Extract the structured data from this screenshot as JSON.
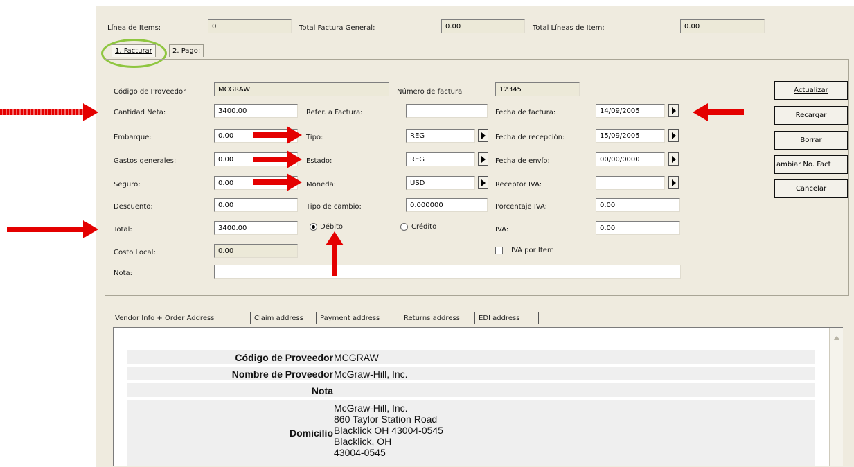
{
  "header": {
    "linea_items_label": "Línea de Items:",
    "linea_items_value": "0",
    "total_factura_label": "Total Factura General:",
    "total_factura_value": "0.00",
    "total_lineas_label": "Total Líneas de Item:",
    "total_lineas_value": "0.00"
  },
  "tabs": [
    "1. Facturar",
    "2. Pago:"
  ],
  "form": {
    "codigo_proveedor_label": "Código de Proveedor",
    "codigo_proveedor_value": "MCGRAW",
    "numero_factura_label": "Número de factura",
    "numero_factura_value": "12345",
    "cantidad_neta_label": "Cantidad Neta:",
    "cantidad_neta_value": "3400.00",
    "embarque_label": "Embarque:",
    "embarque_value": "0.00",
    "gastos_label": "Gastos generales:",
    "gastos_value": "0.00",
    "seguro_label": "Seguro:",
    "seguro_value": "0.00",
    "descuento_label": "Descuento:",
    "descuento_value": "0.00",
    "total_label": "Total:",
    "total_value": "3400.00",
    "costo_local_label": "Costo Local:",
    "costo_local_value": "0.00",
    "nota_label": "Nota:",
    "nota_value": "",
    "refer_label": "Refer. a Factura:",
    "refer_value": "",
    "tipo_label": "Tipo:",
    "tipo_value": "REG",
    "estado_label": "Estado:",
    "estado_value": "REG",
    "moneda_label": "Moneda:",
    "moneda_value": "USD",
    "tipo_cambio_label": "Tipo de cambio:",
    "tipo_cambio_value": "0.000000",
    "debito_label": "Débito",
    "credito_label": "Crédito",
    "fecha_factura_label": "Fecha de factura:",
    "fecha_factura_value": "14/09/2005",
    "fecha_recepcion_label": "Fecha de recepción:",
    "fecha_recepcion_value": "15/09/2005",
    "fecha_envio_label": "Fecha de envío:",
    "fecha_envio_value": "00/00/0000",
    "receptor_iva_label": "Receptor IVA:",
    "receptor_iva_value": "",
    "porcentaje_iva_label": "Porcentaje IVA:",
    "porcentaje_iva_value": "0.00",
    "iva_label": "IVA:",
    "iva_value": "0.00",
    "iva_por_item_label": "IVA por Item"
  },
  "buttons": {
    "actualizar": "Actualizar",
    "recargar": "Recargar",
    "borrar": "Borrar",
    "cambiar": "ambiar No. Fact",
    "cancelar": "Cancelar"
  },
  "bottom_tabs": [
    "Vendor Info + Order Address",
    "Claim address",
    "Payment address",
    "Returns address",
    "EDI address"
  ],
  "vendor_info": {
    "codigo_label": "Código de Proveedor",
    "codigo_value": "MCGRAW",
    "nombre_label": "Nombre de Proveedor",
    "nombre_value": "McGraw-Hill, Inc.",
    "nota_label": "Nota",
    "domicilio_label": "Domicilio",
    "domicilio_lines": [
      "McGraw-Hill, Inc.",
      "860 Taylor Station Road",
      "Blacklick OH 43004-0545",
      "Blacklick, OH",
      "43004-0545"
    ]
  },
  "colors": {
    "annotation_arrow": "#e40000",
    "annotation_circle": "#8fc640",
    "window_bg": "#efebdf"
  }
}
